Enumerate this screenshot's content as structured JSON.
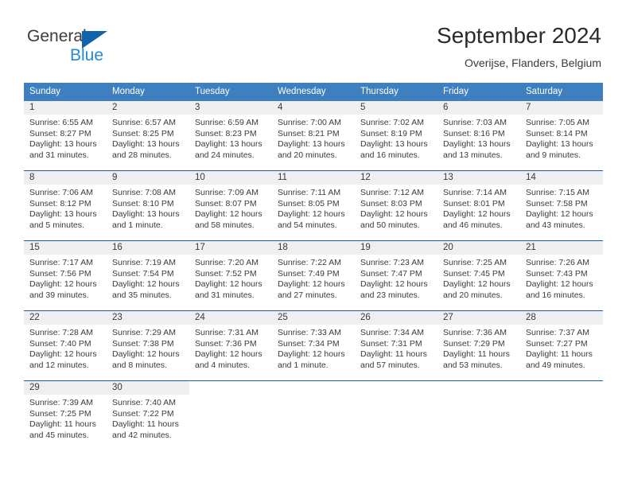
{
  "brand": {
    "name_part1": "General",
    "name_part2": "Blue",
    "triangle_icon": "triangle-logo-icon",
    "accent_dark": "#1263ac",
    "accent_light": "#2389d4"
  },
  "header": {
    "month_title": "September 2024",
    "location": "Overijse, Flanders, Belgium"
  },
  "theme": {
    "header_blue": "#3d7fbf",
    "row_divider_blue": "#1a5fa2",
    "day_band_gray": "#efefef",
    "text_color": "#3a3a3a"
  },
  "weekdays": [
    "Sunday",
    "Monday",
    "Tuesday",
    "Wednesday",
    "Thursday",
    "Friday",
    "Saturday"
  ],
  "weeks": [
    [
      {
        "day": "1",
        "sunrise": "Sunrise: 6:55 AM",
        "sunset": "Sunset: 8:27 PM",
        "daylight": "Daylight: 13 hours and 31 minutes."
      },
      {
        "day": "2",
        "sunrise": "Sunrise: 6:57 AM",
        "sunset": "Sunset: 8:25 PM",
        "daylight": "Daylight: 13 hours and 28 minutes."
      },
      {
        "day": "3",
        "sunrise": "Sunrise: 6:59 AM",
        "sunset": "Sunset: 8:23 PM",
        "daylight": "Daylight: 13 hours and 24 minutes."
      },
      {
        "day": "4",
        "sunrise": "Sunrise: 7:00 AM",
        "sunset": "Sunset: 8:21 PM",
        "daylight": "Daylight: 13 hours and 20 minutes."
      },
      {
        "day": "5",
        "sunrise": "Sunrise: 7:02 AM",
        "sunset": "Sunset: 8:19 PM",
        "daylight": "Daylight: 13 hours and 16 minutes."
      },
      {
        "day": "6",
        "sunrise": "Sunrise: 7:03 AM",
        "sunset": "Sunset: 8:16 PM",
        "daylight": "Daylight: 13 hours and 13 minutes."
      },
      {
        "day": "7",
        "sunrise": "Sunrise: 7:05 AM",
        "sunset": "Sunset: 8:14 PM",
        "daylight": "Daylight: 13 hours and 9 minutes."
      }
    ],
    [
      {
        "day": "8",
        "sunrise": "Sunrise: 7:06 AM",
        "sunset": "Sunset: 8:12 PM",
        "daylight": "Daylight: 13 hours and 5 minutes."
      },
      {
        "day": "9",
        "sunrise": "Sunrise: 7:08 AM",
        "sunset": "Sunset: 8:10 PM",
        "daylight": "Daylight: 13 hours and 1 minute."
      },
      {
        "day": "10",
        "sunrise": "Sunrise: 7:09 AM",
        "sunset": "Sunset: 8:07 PM",
        "daylight": "Daylight: 12 hours and 58 minutes."
      },
      {
        "day": "11",
        "sunrise": "Sunrise: 7:11 AM",
        "sunset": "Sunset: 8:05 PM",
        "daylight": "Daylight: 12 hours and 54 minutes."
      },
      {
        "day": "12",
        "sunrise": "Sunrise: 7:12 AM",
        "sunset": "Sunset: 8:03 PM",
        "daylight": "Daylight: 12 hours and 50 minutes."
      },
      {
        "day": "13",
        "sunrise": "Sunrise: 7:14 AM",
        "sunset": "Sunset: 8:01 PM",
        "daylight": "Daylight: 12 hours and 46 minutes."
      },
      {
        "day": "14",
        "sunrise": "Sunrise: 7:15 AM",
        "sunset": "Sunset: 7:58 PM",
        "daylight": "Daylight: 12 hours and 43 minutes."
      }
    ],
    [
      {
        "day": "15",
        "sunrise": "Sunrise: 7:17 AM",
        "sunset": "Sunset: 7:56 PM",
        "daylight": "Daylight: 12 hours and 39 minutes."
      },
      {
        "day": "16",
        "sunrise": "Sunrise: 7:19 AM",
        "sunset": "Sunset: 7:54 PM",
        "daylight": "Daylight: 12 hours and 35 minutes."
      },
      {
        "day": "17",
        "sunrise": "Sunrise: 7:20 AM",
        "sunset": "Sunset: 7:52 PM",
        "daylight": "Daylight: 12 hours and 31 minutes."
      },
      {
        "day": "18",
        "sunrise": "Sunrise: 7:22 AM",
        "sunset": "Sunset: 7:49 PM",
        "daylight": "Daylight: 12 hours and 27 minutes."
      },
      {
        "day": "19",
        "sunrise": "Sunrise: 7:23 AM",
        "sunset": "Sunset: 7:47 PM",
        "daylight": "Daylight: 12 hours and 23 minutes."
      },
      {
        "day": "20",
        "sunrise": "Sunrise: 7:25 AM",
        "sunset": "Sunset: 7:45 PM",
        "daylight": "Daylight: 12 hours and 20 minutes."
      },
      {
        "day": "21",
        "sunrise": "Sunrise: 7:26 AM",
        "sunset": "Sunset: 7:43 PM",
        "daylight": "Daylight: 12 hours and 16 minutes."
      }
    ],
    [
      {
        "day": "22",
        "sunrise": "Sunrise: 7:28 AM",
        "sunset": "Sunset: 7:40 PM",
        "daylight": "Daylight: 12 hours and 12 minutes."
      },
      {
        "day": "23",
        "sunrise": "Sunrise: 7:29 AM",
        "sunset": "Sunset: 7:38 PM",
        "daylight": "Daylight: 12 hours and 8 minutes."
      },
      {
        "day": "24",
        "sunrise": "Sunrise: 7:31 AM",
        "sunset": "Sunset: 7:36 PM",
        "daylight": "Daylight: 12 hours and 4 minutes."
      },
      {
        "day": "25",
        "sunrise": "Sunrise: 7:33 AM",
        "sunset": "Sunset: 7:34 PM",
        "daylight": "Daylight: 12 hours and 1 minute."
      },
      {
        "day": "26",
        "sunrise": "Sunrise: 7:34 AM",
        "sunset": "Sunset: 7:31 PM",
        "daylight": "Daylight: 11 hours and 57 minutes."
      },
      {
        "day": "27",
        "sunrise": "Sunrise: 7:36 AM",
        "sunset": "Sunset: 7:29 PM",
        "daylight": "Daylight: 11 hours and 53 minutes."
      },
      {
        "day": "28",
        "sunrise": "Sunrise: 7:37 AM",
        "sunset": "Sunset: 7:27 PM",
        "daylight": "Daylight: 11 hours and 49 minutes."
      }
    ],
    [
      {
        "day": "29",
        "sunrise": "Sunrise: 7:39 AM",
        "sunset": "Sunset: 7:25 PM",
        "daylight": "Daylight: 11 hours and 45 minutes."
      },
      {
        "day": "30",
        "sunrise": "Sunrise: 7:40 AM",
        "sunset": "Sunset: 7:22 PM",
        "daylight": "Daylight: 11 hours and 42 minutes."
      },
      {
        "day": "",
        "sunrise": "",
        "sunset": "",
        "daylight": ""
      },
      {
        "day": "",
        "sunrise": "",
        "sunset": "",
        "daylight": ""
      },
      {
        "day": "",
        "sunrise": "",
        "sunset": "",
        "daylight": ""
      },
      {
        "day": "",
        "sunrise": "",
        "sunset": "",
        "daylight": ""
      },
      {
        "day": "",
        "sunrise": "",
        "sunset": "",
        "daylight": ""
      }
    ]
  ]
}
